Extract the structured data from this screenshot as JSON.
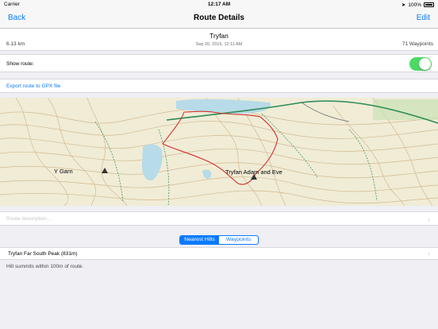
{
  "status": {
    "carrier": "Carrier",
    "time": "12:17 AM",
    "battery": "100%"
  },
  "nav": {
    "back": "Back",
    "title": "Route Details",
    "edit": "Edit"
  },
  "route": {
    "name": "Tryfan",
    "date": "Sep 20, 2016, 12:11 AM",
    "distance": "6.13 km",
    "waypoints": "71 Waypoints"
  },
  "show_route": {
    "label": "Show route:",
    "enabled": true
  },
  "export": {
    "label": "Export route to GPX file"
  },
  "map": {
    "labels": {
      "y_garn": "Y Garn",
      "tryfan": "Tryfan Adam and Eve"
    },
    "colors": {
      "terrain": "#f0ecd6",
      "contour": "#c9a878",
      "route": "#d32f2f",
      "water": "#b7dbe8",
      "road": "#2e8b57"
    }
  },
  "description": {
    "placeholder": "Route description..."
  },
  "segments": {
    "nearest": "Nearest Hills",
    "waypoints": "Waypoints",
    "selected": "nearest"
  },
  "hills": [
    {
      "label": "Tryfan Far South Peak (831m)"
    }
  ],
  "footnote": "Hill summits within 100m of route.",
  "accent": "#0a7aff"
}
